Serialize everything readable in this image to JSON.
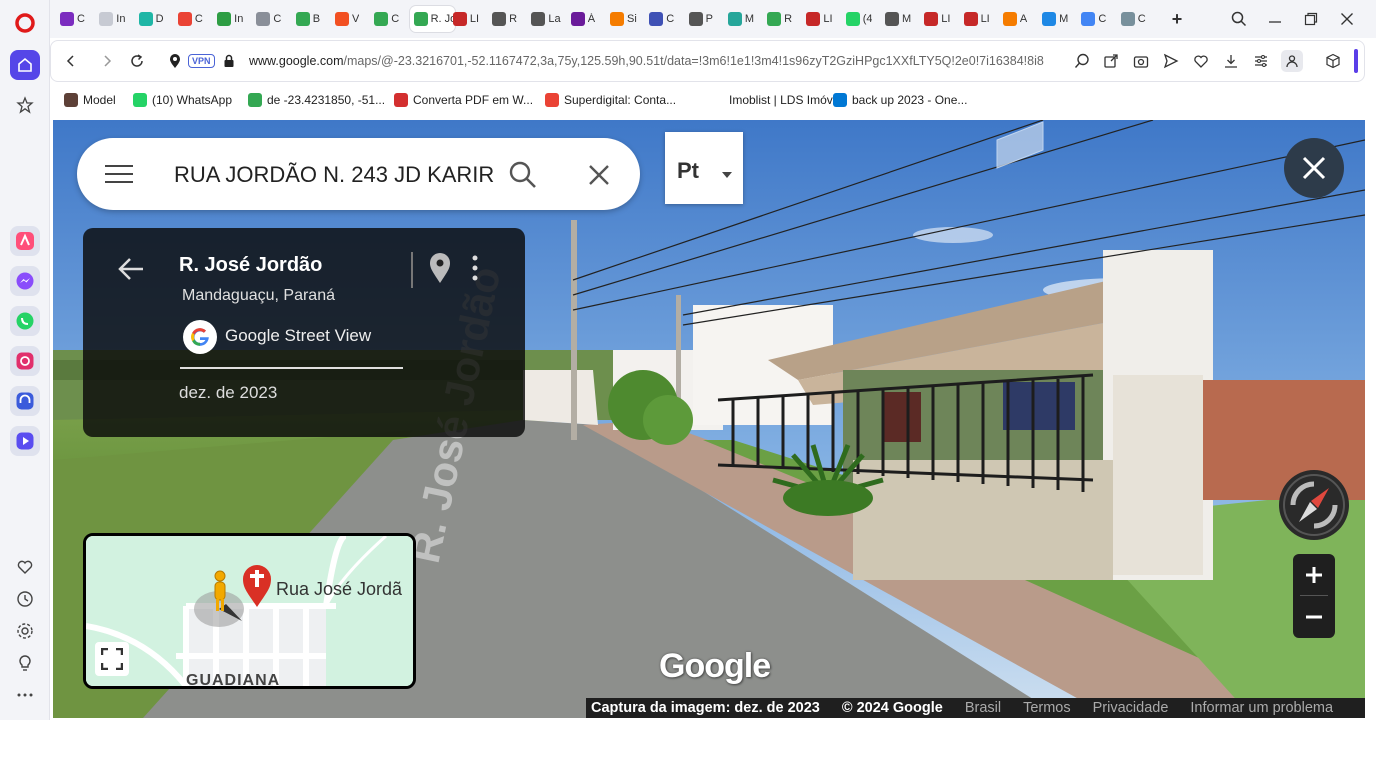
{
  "browser": {
    "tabs": [
      {
        "label": "C",
        "color": "#7b2cbf"
      },
      {
        "label": "In",
        "color": "#c7cad3"
      },
      {
        "label": "D",
        "color": "#1fb6a6"
      },
      {
        "label": "C",
        "color": "#ea4335"
      },
      {
        "label": "In",
        "color": "#2e9d44"
      },
      {
        "label": "C",
        "color": "#8a8f99"
      },
      {
        "label": "B",
        "color": "#34a853"
      },
      {
        "label": "V",
        "color": "#f25022"
      },
      {
        "label": "C",
        "color": "#34a853"
      },
      {
        "label": "R. Jo",
        "color": "#34a853",
        "active": true
      },
      {
        "label": "LI",
        "color": "#c62828"
      },
      {
        "label": "R",
        "color": "#555555"
      },
      {
        "label": "La",
        "color": "#555555"
      },
      {
        "label": "Á",
        "color": "#6a1b9a"
      },
      {
        "label": "Si",
        "color": "#f57c00"
      },
      {
        "label": "C",
        "color": "#3f51b5"
      },
      {
        "label": "P",
        "color": "#555555"
      },
      {
        "label": "M",
        "color": "#26a69a"
      },
      {
        "label": "R",
        "color": "#34a853"
      },
      {
        "label": "LI",
        "color": "#c62828"
      },
      {
        "label": "(4",
        "color": "#25d366"
      },
      {
        "label": "M",
        "color": "#555555"
      },
      {
        "label": "LI",
        "color": "#c62828"
      },
      {
        "label": "LI",
        "color": "#c62828"
      },
      {
        "label": "A",
        "color": "#f57c00"
      },
      {
        "label": "M",
        "color": "#1e88e5"
      },
      {
        "label": "C",
        "color": "#4285f4"
      },
      {
        "label": "C",
        "color": "#78909c"
      }
    ],
    "url_host": "www.google.com",
    "url_path": "/maps/@-23.3216701,-52.1167472,3a,75y,125.59h,90.51t/data=!3m6!1e1!3m4!1s96zyT2GziHPgc1XXfLTY5Q!2e0!7i16384!8i8",
    "vpn_label": "VPN",
    "bookmarks": [
      {
        "label": "Model",
        "color": "#5d4037"
      },
      {
        "label": "(10) WhatsApp",
        "color": "#25d366"
      },
      {
        "label": "de -23.4231850, -51...",
        "color": "#34a853"
      },
      {
        "label": "Converta PDF em W...",
        "color": "#d32f2f"
      },
      {
        "label": "Superdigital: Conta...",
        "color": "#ea4335"
      },
      {
        "label": "Imoblist | LDS Imóv...",
        "color": "#ffffff"
      },
      {
        "label": "back up 2023 - One...",
        "color": "#0078d4"
      }
    ]
  },
  "maps": {
    "search_value": "RUA JORDÃO N. 243 JD KARIR",
    "pegman_button": "Pt",
    "card": {
      "title": "R. José Jordão",
      "subtitle": "Mandaguaçu, Paraná",
      "source": "Google Street View",
      "date": "dez. de 2023"
    },
    "minimap": {
      "label": "Rua José Jordã",
      "area_label": "GUADIANA"
    },
    "street_sign": "R. José Jordão",
    "logo": "Google",
    "footer": {
      "capture": "Captura da imagem: dez. de 2023",
      "copyright": "© 2024 Google",
      "links": [
        "Brasil",
        "Termos",
        "Privacidade",
        "Informar um problema"
      ]
    }
  }
}
